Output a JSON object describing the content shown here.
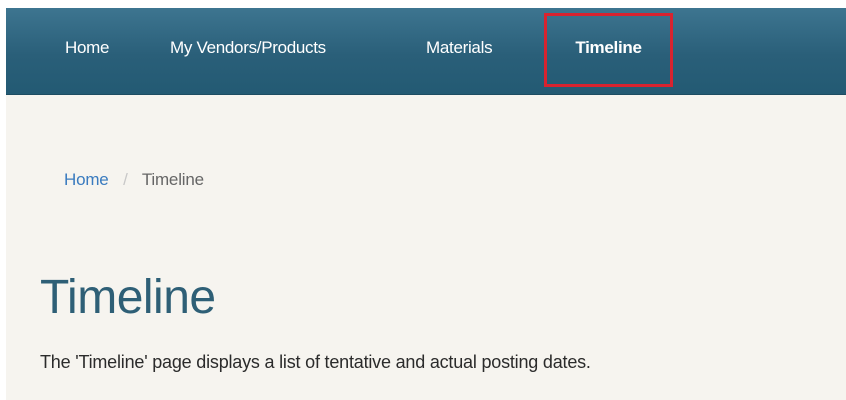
{
  "nav": {
    "items": [
      {
        "label": "Home"
      },
      {
        "label": "My Vendors/Products"
      },
      {
        "label": "Materials"
      },
      {
        "label": "Timeline"
      }
    ],
    "active": "Timeline",
    "highlight_color": "#d8232f",
    "bar_color": "#2a5f79"
  },
  "breadcrumb": {
    "home": "Home",
    "separator": "/",
    "current": "Timeline"
  },
  "page": {
    "title": "Timeline",
    "description": "The 'Timeline' page displays a list of tentative and actual posting dates."
  },
  "colors": {
    "background": "#f6f4ef",
    "title": "#2e5f76",
    "link": "#3a7bbf"
  }
}
